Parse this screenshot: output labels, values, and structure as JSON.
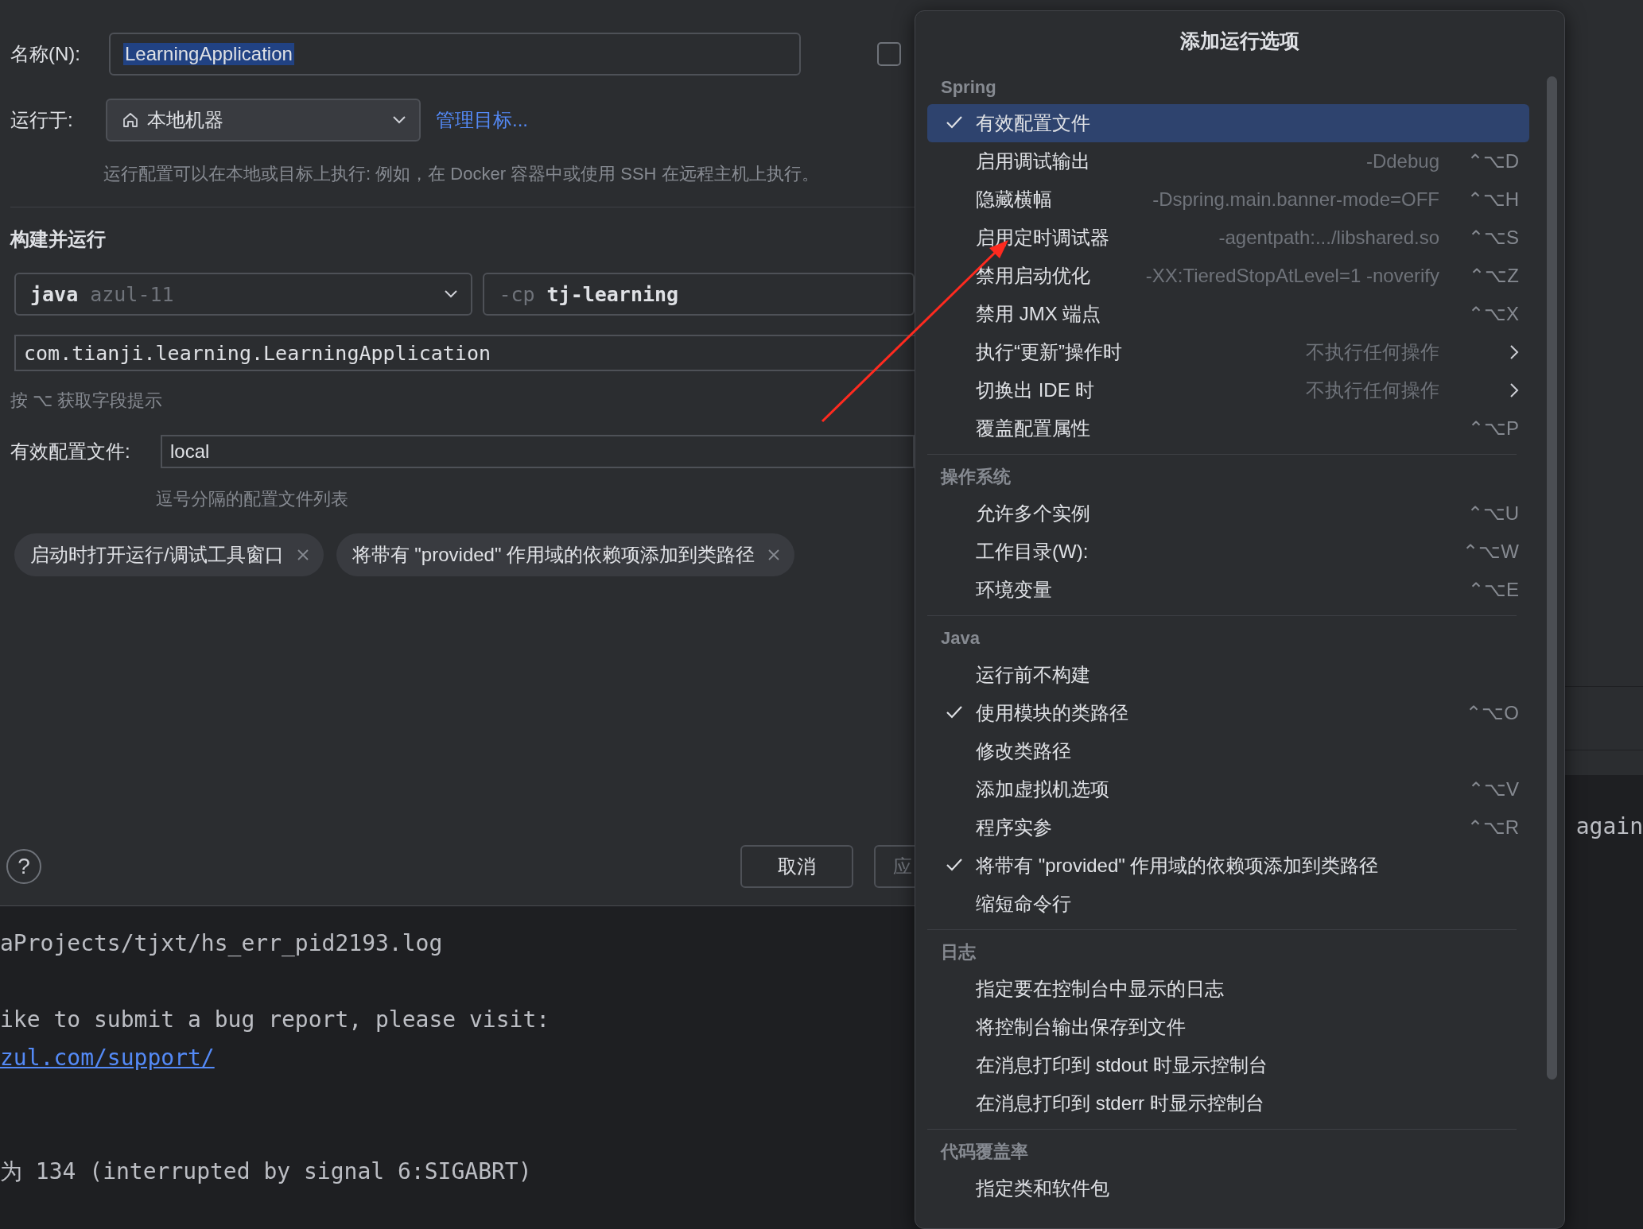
{
  "dialog": {
    "name_label": "名称(N):",
    "name_value": "LearningApplication",
    "name_text_selected": true,
    "store_checkbox": {
      "checked": false
    },
    "run_on_label": "运行于:",
    "run_on_value": "本地机器",
    "manage_link": "管理目标...",
    "run_on_hint": "运行配置可以在本地或目标上执行: 例如，在 Docker 容器中或使用 SSH 在远程主机上执行。",
    "section_title": "构建并运行",
    "jre": {
      "name": "java",
      "version": "azul-11"
    },
    "classpath": {
      "flag": "-cp",
      "module": "tj-learning"
    },
    "main_class": "com.tianji.learning.LearningApplication",
    "field_hint": "按 ⌥ 获取字段提示",
    "profiles_label": "有效配置文件:",
    "profiles_value": "local",
    "profiles_hint": "逗号分隔的配置文件列表",
    "chips": [
      "启动时打开运行/调试工具窗口",
      "将带有 \"provided\" 作用域的依赖项添加到类路径"
    ],
    "help": "?",
    "buttons": [
      {
        "label": "取消",
        "kind": "cancel"
      },
      {
        "label": "应",
        "kind": "apply"
      }
    ]
  },
  "console": {
    "lines": [
      {
        "kind": "text",
        "text": "aProjects/tjxt/hs_err_pid2193.log"
      },
      {
        "kind": "blank"
      },
      {
        "kind": "text",
        "text": "ike to submit a bug report, please visit:"
      },
      {
        "kind": "link",
        "text": "zul.com/support/"
      },
      {
        "kind": "blank"
      },
      {
        "kind": "blank"
      },
      {
        "kind": "text",
        "text": "为 134 (interrupted by signal 6:SIGABRT)"
      }
    ],
    "side_text": "again"
  },
  "popup": {
    "title": "添加运行选项",
    "sections": [
      {
        "header": "Spring",
        "items": [
          {
            "label": "有效配置文件",
            "checked": true,
            "selected": true
          },
          {
            "label": "启用调试输出",
            "hint": "-Ddebug",
            "shortcut": "⌃⌥D",
            "checked": false,
            "selected": false
          },
          {
            "label": "隐藏横幅",
            "hint": "-Dspring.main.banner-mode=OFF",
            "shortcut": "⌃⌥H",
            "checked": false,
            "selected": false
          },
          {
            "label": "启用定时调试器",
            "hint": "-agentpath:.../libshared.so",
            "shortcut": "⌃⌥S",
            "checked": false,
            "selected": false
          },
          {
            "label": "禁用启动优化",
            "hint": "-XX:TieredStopAtLevel=1 -noverify",
            "shortcut": "⌃⌥Z",
            "checked": false,
            "selected": false
          },
          {
            "label": "禁用 JMX 端点",
            "shortcut": "⌃⌥X",
            "checked": false,
            "selected": false
          },
          {
            "label": "执行“更新”操作时",
            "hint": "不执行任何操作",
            "submenu": true,
            "checked": false,
            "selected": false
          },
          {
            "label": "切换出 IDE 时",
            "hint": "不执行任何操作",
            "submenu": true,
            "checked": false,
            "selected": false
          },
          {
            "label": "覆盖配置属性",
            "shortcut": "⌃⌥P",
            "checked": false,
            "selected": false
          }
        ]
      },
      {
        "header": "操作系统",
        "items": [
          {
            "label": "允许多个实例",
            "shortcut": "⌃⌥U",
            "checked": false,
            "selected": false
          },
          {
            "label": "工作目录(W):",
            "shortcut": "⌃⌥W",
            "checked": false,
            "selected": false
          },
          {
            "label": "环境变量",
            "shortcut": "⌃⌥E",
            "checked": false,
            "selected": false
          }
        ]
      },
      {
        "header": "Java",
        "items": [
          {
            "label": "运行前不构建",
            "checked": false,
            "selected": false
          },
          {
            "label": "使用模块的类路径",
            "shortcut": "⌃⌥O",
            "checked": true,
            "selected": false
          },
          {
            "label": "修改类路径",
            "checked": false,
            "selected": false
          },
          {
            "label": "添加虚拟机选项",
            "shortcut": "⌃⌥V",
            "checked": false,
            "selected": false
          },
          {
            "label": "程序实参",
            "shortcut": "⌃⌥R",
            "checked": false,
            "selected": false
          },
          {
            "label": "将带有 \"provided\" 作用域的依赖项添加到类路径",
            "checked": true,
            "selected": false
          },
          {
            "label": "缩短命令行",
            "checked": false,
            "selected": false
          }
        ]
      },
      {
        "header": "日志",
        "items": [
          {
            "label": "指定要在控制台中显示的日志",
            "checked": false,
            "selected": false
          },
          {
            "label": "将控制台输出保存到文件",
            "checked": false,
            "selected": false
          },
          {
            "label": "在消息打印到 stdout 时显示控制台",
            "checked": false,
            "selected": false
          },
          {
            "label": "在消息打印到 stderr 时显示控制台",
            "checked": false,
            "selected": false
          }
        ]
      },
      {
        "header": "代码覆盖率",
        "items": [
          {
            "label": "指定类和软件包",
            "checked": false,
            "selected": false
          }
        ]
      }
    ]
  },
  "annotation": {
    "kind": "arrow"
  }
}
